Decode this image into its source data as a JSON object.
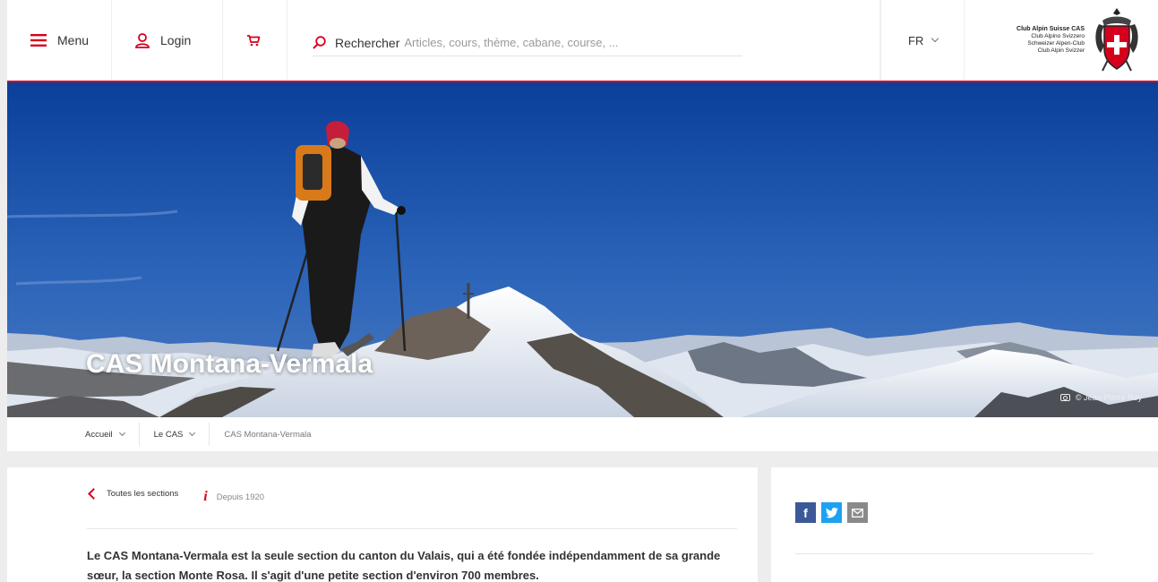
{
  "header": {
    "menu_label": "Menu",
    "login_label": "Login",
    "search_label": "Rechercher",
    "search_placeholder": "Articles, cours, thème, cabane, course, ...",
    "language": "FR",
    "logo_lines": [
      "Club Alpin Suisse CAS",
      "Club Alpino Svizzero",
      "Schweizer Alpen-Club",
      "Club Alpin Svizzer"
    ]
  },
  "hero": {
    "title": "CAS Montana-Vermala",
    "credit": "© Jean-Pierre Rey"
  },
  "breadcrumb": {
    "items": [
      "Accueil",
      "Le CAS",
      "CAS Montana-Vermala"
    ]
  },
  "main": {
    "back_label": "Toutes les sections",
    "since_label": "Depuis 1920",
    "intro": "Le CAS Montana-Vermala est la seule section du canton du Valais, qui a été fondée indépendamment de sa grande sœur, la section Monte Rosa. Il s'agit d'une petite section d'environ 700 membres."
  },
  "colors": {
    "accent": "#d6001c",
    "facebook": "#3b5998",
    "twitter": "#1da1f2",
    "email": "#8a8a8a"
  },
  "icons": [
    "menu-icon",
    "user-icon",
    "cart-icon",
    "search-icon",
    "chevron-down-icon",
    "camera-icon",
    "back-arrow-icon",
    "info-icon",
    "facebook-icon",
    "twitter-icon",
    "email-icon"
  ]
}
